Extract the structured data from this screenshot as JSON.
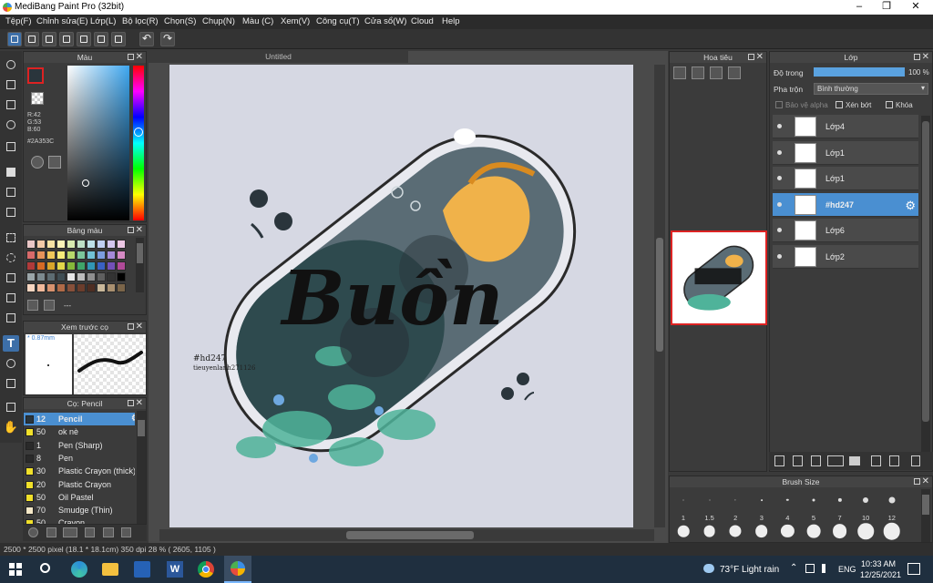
{
  "window": {
    "title": "MediBang Paint Pro (32bit)"
  },
  "menu": [
    "Tệp(F)",
    "Chỉnh sửa(E)",
    "Lớp(L)",
    "Bộ lọc(R)",
    "Chọn(S)",
    "Chụp(N)",
    "Màu (C)",
    "Xem(V)",
    "Công cụ(T)",
    "Cửa sổ(W)",
    "Cloud",
    "Help"
  ],
  "color_panel": {
    "title": "Màu",
    "current_color": "#2A353C",
    "rgb": [
      "R:42",
      "G:53",
      "B:60"
    ],
    "hex_label": "#2A353C"
  },
  "palette_panel": {
    "title": "Bảng màu",
    "dash": "---"
  },
  "preview_panel": {
    "title": "Xem trước cọ",
    "size": "* 0.87mm"
  },
  "brush_panel": {
    "title": "Cọ: Pencil",
    "brushes": [
      {
        "size": "12",
        "name": "Pencil",
        "color": "#2A353C",
        "selected": true
      },
      {
        "size": "50",
        "name": "ok nè",
        "color": "#f1e02a"
      },
      {
        "size": "1",
        "name": "Pen (Sharp)",
        "color": "#2a2a2a"
      },
      {
        "size": "8",
        "name": "Pen",
        "color": "#2a2a2a"
      },
      {
        "size": "30",
        "name": "Plastic Crayon (thick)",
        "color": "#f1e02a"
      },
      {
        "size": "20",
        "name": "Plastic Crayon",
        "color": "#f1e02a"
      },
      {
        "size": "50",
        "name": "Oil Pastel",
        "color": "#f1e02a"
      },
      {
        "size": "70",
        "name": "Smudge (Thin)",
        "color": "#f5e8c8"
      },
      {
        "size": "50",
        "name": "Crayon",
        "color": "#f1e02a"
      }
    ]
  },
  "document": {
    "tab": "Untitled",
    "artwork_text": "Buồn",
    "watermark_lines": [
      "#hd247",
      "tieuyenlanh271126"
    ]
  },
  "navigator": {
    "title": "Hoa tiêu"
  },
  "layers_panel": {
    "title": "Lớp",
    "opacity_label": "Độ trong",
    "opacity_value": "100 %",
    "opacity_fraction": 1.0,
    "blend_label": "Pha trộn",
    "blend_value": "Bình thường",
    "protect_alpha": "Bảo vệ alpha",
    "clip": "Xén bớt",
    "lock": "Khóa",
    "layers": [
      {
        "name": "Lớp4",
        "selected": false
      },
      {
        "name": "Lớp1",
        "selected": false
      },
      {
        "name": "Lớp1",
        "selected": false
      },
      {
        "name": "#hd247",
        "selected": true
      },
      {
        "name": "Lớp6",
        "selected": false
      },
      {
        "name": "Lớp2",
        "selected": false
      }
    ]
  },
  "brush_size_panel": {
    "title": "Brush Size",
    "sizes": [
      "1",
      "1.5",
      "2",
      "3",
      "4",
      "5",
      "7",
      "10",
      "12"
    ]
  },
  "status": {
    "text": "2500 * 2500 pixel   (18.1 * 18.1cm)   350 dpi   28 %   ( 2605, 1105 )"
  },
  "taskbar": {
    "weather": "73°F  Light rain",
    "lang": "ENG",
    "time": "10:33 AM",
    "date": "12/25/2021"
  }
}
